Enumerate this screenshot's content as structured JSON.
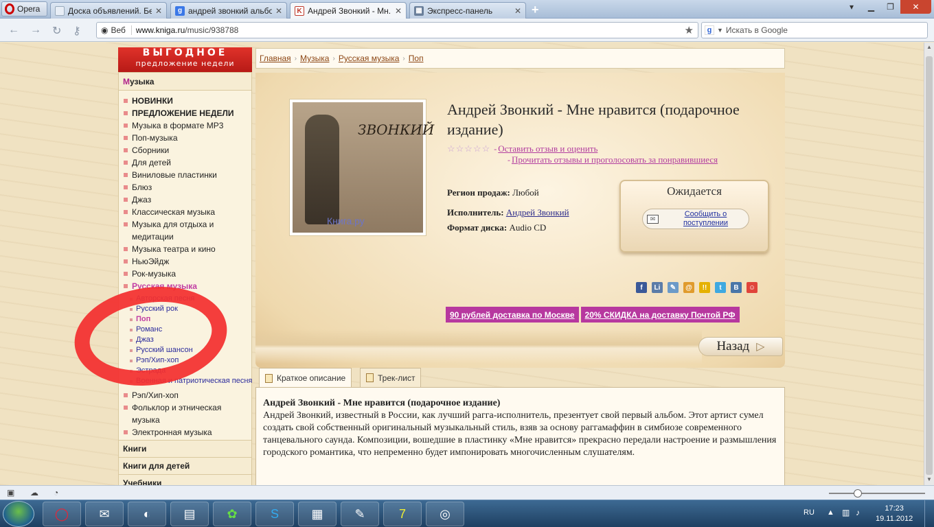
{
  "browser": {
    "opera_label": "Opera",
    "tabs": [
      {
        "label": "Доска объявлений. Бе...",
        "fav": "",
        "color": "#e8eef6"
      },
      {
        "label": "андрей звонкий альбо...",
        "fav": "g",
        "color": "#3b78e7"
      },
      {
        "label": "Андрей Звонкий - Мн...",
        "fav": "K",
        "color": "#c0392b"
      },
      {
        "label": "Экспресс-панель",
        "fav": "▦",
        "color": "#6a7f9a"
      }
    ],
    "address_prefix": "Веб",
    "address_domain": "www.kniga.ru",
    "address_path": "/music/938788",
    "search_placeholder": "Искать в Google"
  },
  "promo": {
    "line1": "ВЫГОДНОЕ",
    "line2": "предложение недели"
  },
  "sidebar": {
    "head_m": "М",
    "head_rest": "узыка",
    "items": [
      "НОВИНКИ",
      "ПРЕДЛОЖЕНИЕ НЕДЕЛИ",
      "Музыка в формате MP3",
      "Поп-музыка",
      "Сборники",
      "Для детей",
      "Виниловые пластинки",
      "Блюз",
      "Джаз",
      "Классическая музыка",
      "Музыка для отдыха и медитации",
      "Музыка театра и кино",
      "НьюЭйдж",
      "Рок-музыка",
      "Русская музыка"
    ],
    "subitems": [
      "Авторская песня",
      "Русский рок",
      "Поп",
      "Романс",
      "Джаз",
      "Русский шансон",
      "Рэп/Хип-хоп",
      "Эстрада",
      "Военная и патриотическая песня"
    ],
    "items_after": [
      "Рэп/Хип-хоп",
      "Фольклор и этническая музыка",
      "Электронная музыка"
    ],
    "sections": [
      "Книги",
      "Книги для детей",
      "Учебники"
    ]
  },
  "breadcrumb": [
    "Главная",
    "Музыка",
    "Русская музыка",
    "Поп"
  ],
  "product": {
    "title": "Андрей Звонкий - Мне нравится (подарочное издание)",
    "stars": "☆☆☆☆☆",
    "review_link": "Оставить отзыв и оценить",
    "read_link": "Прочитать отзывы и проголосовать за понравившиеся",
    "region_label": "Регион продаж:",
    "region_value": "Любой",
    "artist_label": "Исполнитель:",
    "artist_value": "Андрей Звонкий",
    "format_label": "Формат диска:",
    "format_value": "Audio CD",
    "cover_signature": "ЗВОНКИЙ",
    "cover_watermark": "Книга.ру",
    "status": "Ожидается",
    "notify_label": "Сообщить о поступлении",
    "delivery1": "90 рублей доставка по Москве",
    "delivery2": "20% СКИДКА на доставку Почтой РФ",
    "back_label": "Назад"
  },
  "social": [
    {
      "t": "f",
      "c": "#3b5998"
    },
    {
      "t": "Li",
      "c": "#5b7ca8"
    },
    {
      "t": "✎",
      "c": "#6c9ac8"
    },
    {
      "t": "@",
      "c": "#e09b2d"
    },
    {
      "t": "!!",
      "c": "#e5b100"
    },
    {
      "t": "t",
      "c": "#3fa9e0"
    },
    {
      "t": "B",
      "c": "#4a76a8"
    },
    {
      "t": "☺",
      "c": "#e0443a"
    }
  ],
  "tabs": [
    "Краткое описание",
    "Трек-лист"
  ],
  "description": {
    "heading": "Андрей Звонкий - Мне нравится (подарочное издание)",
    "text": "Андрей Звонкий, известный в России, как лучший рагга-исполнитель, презентует свой первый альбом. Этот артист сумел создать свой собственный оригинальный музыкальный стиль, взяв за основу раггамаффин в симбиозе современного танцевального саунда. Композиции, вошедшие в пластинку «Мне нравится» прекрасно передали настроение и размышления городского романтика, что непременно будет импонировать многочисленным слушателям."
  },
  "taskbar": {
    "lang": "RU",
    "time": "17:23",
    "date": "19.11.2012"
  }
}
